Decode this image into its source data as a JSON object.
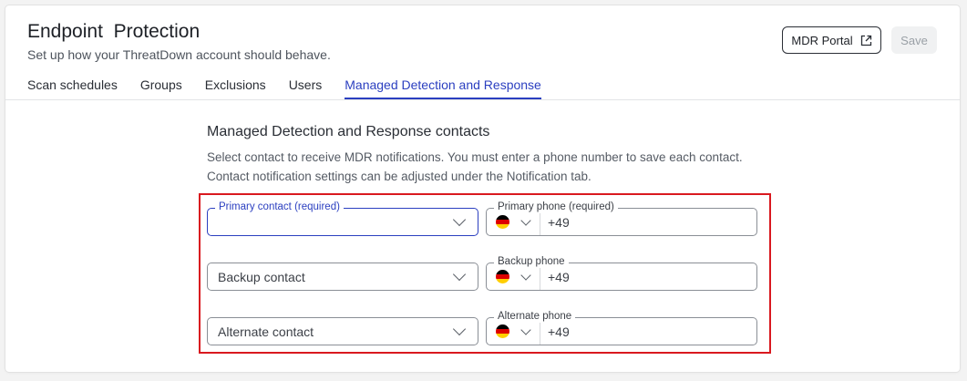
{
  "header": {
    "title": "Endpoint  Protection",
    "subtitle": "Set up how your ThreatDown account should behave.",
    "portal_button": "MDR Portal",
    "save_button": "Save"
  },
  "tabs": [
    {
      "label": "Scan schedules",
      "active": false
    },
    {
      "label": "Groups",
      "active": false
    },
    {
      "label": "Exclusions",
      "active": false
    },
    {
      "label": "Users",
      "active": false
    },
    {
      "label": "Managed Detection and Response",
      "active": true
    }
  ],
  "section": {
    "title": "Managed Detection and Response contacts",
    "description": "Select contact to receive MDR notifications. You must enter a phone number to save each contact. Contact notification settings can be adjusted under the Notification tab."
  },
  "contacts": [
    {
      "contact_label": "Primary contact (required)",
      "contact_value": "",
      "phone_label": "Primary phone (required)",
      "country_code": "+49"
    },
    {
      "contact_placeholder": "Backup contact",
      "phone_label": "Backup phone",
      "country_code": "+49"
    },
    {
      "contact_placeholder": "Alternate contact",
      "phone_label": "Alternate phone",
      "country_code": "+49"
    }
  ],
  "colors": {
    "accent": "#2b3fc0",
    "highlight_border": "#d9191f",
    "flag_de": [
      "#000000",
      "#dd0000",
      "#ffce00"
    ]
  },
  "icons": {
    "portal": "external-link-icon",
    "dropdown": "chevron-down-icon",
    "flag": "germany-flag-icon"
  }
}
